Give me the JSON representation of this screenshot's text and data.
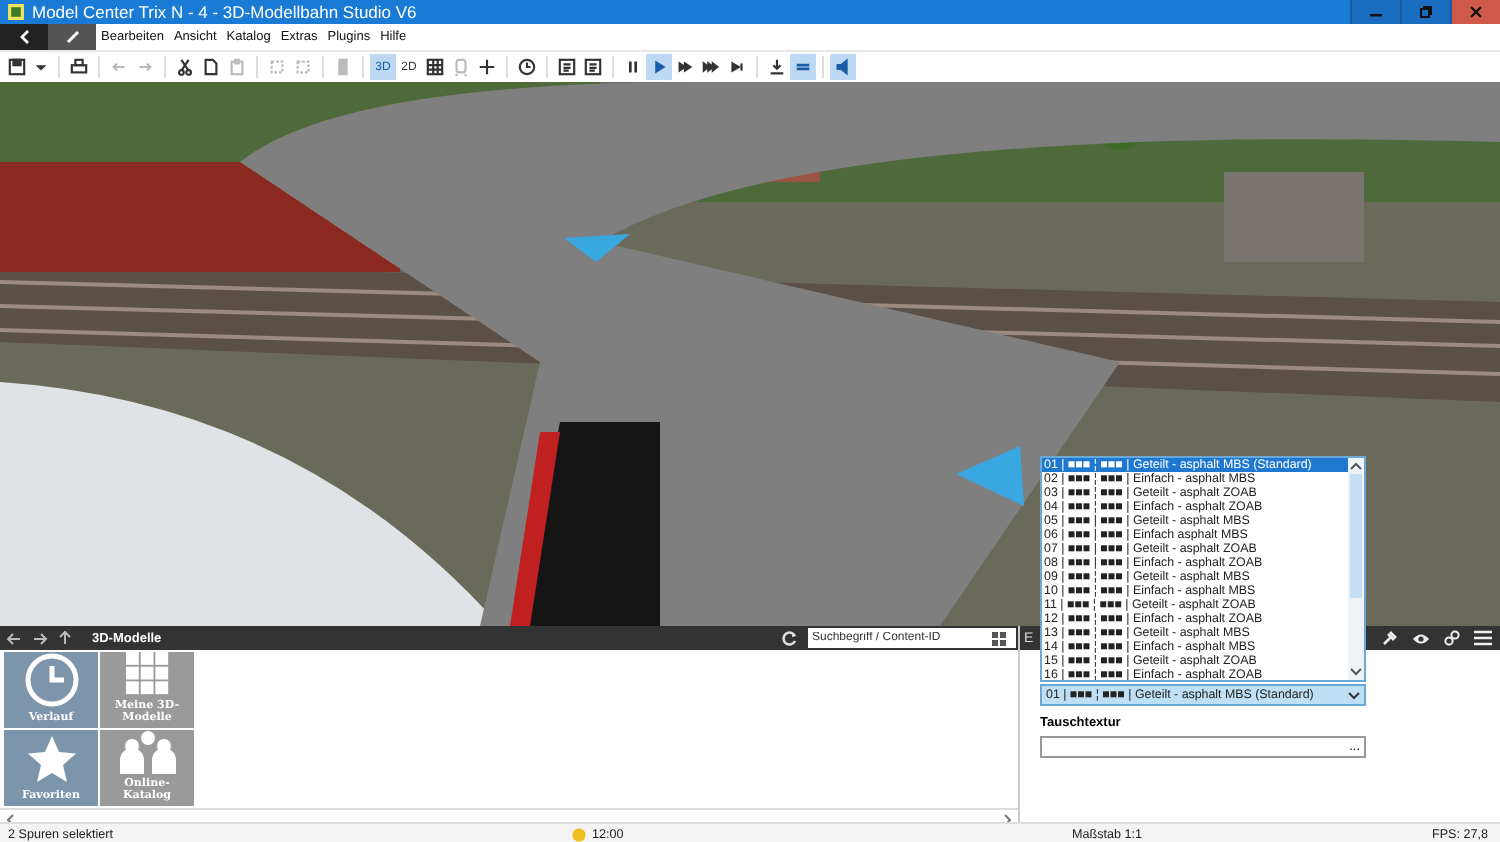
{
  "window": {
    "title": "Model Center Trix N - 4 - 3D-Modellbahn Studio V6"
  },
  "menu": [
    "Bearbeiten",
    "Ansicht",
    "Katalog",
    "Extras",
    "Plugins",
    "Hilfe"
  ],
  "toolbar": [
    {
      "selected": false,
      "disabled": false
    },
    {
      "selected": false,
      "disabled": false
    },
    {
      "selected": false,
      "disabled": false
    },
    {
      "selected": false,
      "disabled": true
    },
    {
      "selected": false,
      "disabled": true
    },
    {
      "selected": false,
      "disabled": false
    },
    {
      "selected": false,
      "disabled": false
    },
    {
      "selected": false,
      "disabled": true
    },
    {
      "selected": false,
      "disabled": true
    },
    {
      "selected": false,
      "disabled": true
    },
    {
      "selected": false,
      "disabled": true
    },
    {
      "selected": true,
      "disabled": false,
      "label": "3D"
    },
    {
      "selected": false,
      "disabled": false,
      "label": "2D"
    },
    {
      "selected": false,
      "disabled": false
    },
    {
      "selected": false,
      "disabled": true
    },
    {
      "selected": false,
      "disabled": false
    },
    {
      "selected": false,
      "disabled": false
    },
    {
      "selected": false,
      "disabled": false
    },
    {
      "selected": false,
      "disabled": false
    },
    {
      "selected": false,
      "disabled": false
    },
    {
      "selected": true,
      "disabled": false
    },
    {
      "selected": false,
      "disabled": false
    },
    {
      "selected": false,
      "disabled": false
    },
    {
      "selected": false,
      "disabled": false
    },
    {
      "selected": false,
      "disabled": false
    },
    {
      "selected": true,
      "disabled": false
    },
    {
      "selected": true,
      "disabled": false
    }
  ],
  "catalog": {
    "title": "3D-Modelle",
    "search_placeholder": "Suchbegriff / Content-ID",
    "tiles": [
      {
        "label": "Verlauf",
        "kind": "history"
      },
      {
        "label": "Meine 3D-Modelle",
        "kind": "mine"
      },
      {
        "label": "Favoriten",
        "kind": "favorites"
      },
      {
        "label": "Online-Katalog",
        "kind": "online"
      }
    ]
  },
  "properties": {
    "header_text": "E",
    "list": [
      {
        "text": "01 | ■■■ ¦ ■■■ | Geteilt - asphalt MBS (Standard)",
        "selected": true
      },
      {
        "text": "02 | ■■■ ¦ ■■■ | Einfach - asphalt MBS",
        "selected": false
      },
      {
        "text": "03 | ■■■ ¦ ■■■ | Geteilt - asphalt ZOAB",
        "selected": false
      },
      {
        "text": "04 | ■■■ ¦ ■■■ | Einfach - asphalt ZOAB",
        "selected": false
      },
      {
        "text": "05 | ■■■ | ■■■ | Geteilt - asphalt MBS",
        "selected": false
      },
      {
        "text": "06 | ■■■ | ■■■ | Einfach asphalt MBS",
        "selected": false
      },
      {
        "text": "07 | ■■■ | ■■■ | Geteilt - asphalt ZOAB",
        "selected": false
      },
      {
        "text": "08 | ■■■ | ■■■ | Einfach - asphalt ZOAB",
        "selected": false
      },
      {
        "text": "09 | ■■■ ¦ ■■■ | Geteilt - asphalt MBS",
        "selected": false
      },
      {
        "text": "10 | ■■■ ¦ ■■■ | Einfach - asphalt MBS",
        "selected": false
      },
      {
        "text": "11 | ■■■ ¦ ■■■ | Geteilt - asphalt ZOAB",
        "selected": false
      },
      {
        "text": "12 | ■■■ ¦ ■■■ | Einfach - asphalt ZOAB",
        "selected": false
      },
      {
        "text": "13 | ■■■ ¦ ■■■ | Geteilt - asphalt MBS",
        "selected": false
      },
      {
        "text": "14 | ■■■ ¦ ■■■ | Einfach - asphalt MBS",
        "selected": false
      },
      {
        "text": "15 | ■■■ ¦ ■■■ | Geteilt - asphalt ZOAB",
        "selected": false
      },
      {
        "text": "16 | ■■■ ¦ ■■■ | Einfach - asphalt ZOAB",
        "selected": false
      }
    ],
    "value": "01 | ■■■ ¦ ■■■ | Geteilt - asphalt MBS (Standard)",
    "texture_label": "Tauschtextur",
    "browse_button": "..."
  },
  "status_bar": {
    "left": "2 Spuren selektiert",
    "time": "12:00",
    "scale": "Maßstab 1:1",
    "fps": "FPS: 27,8"
  }
}
